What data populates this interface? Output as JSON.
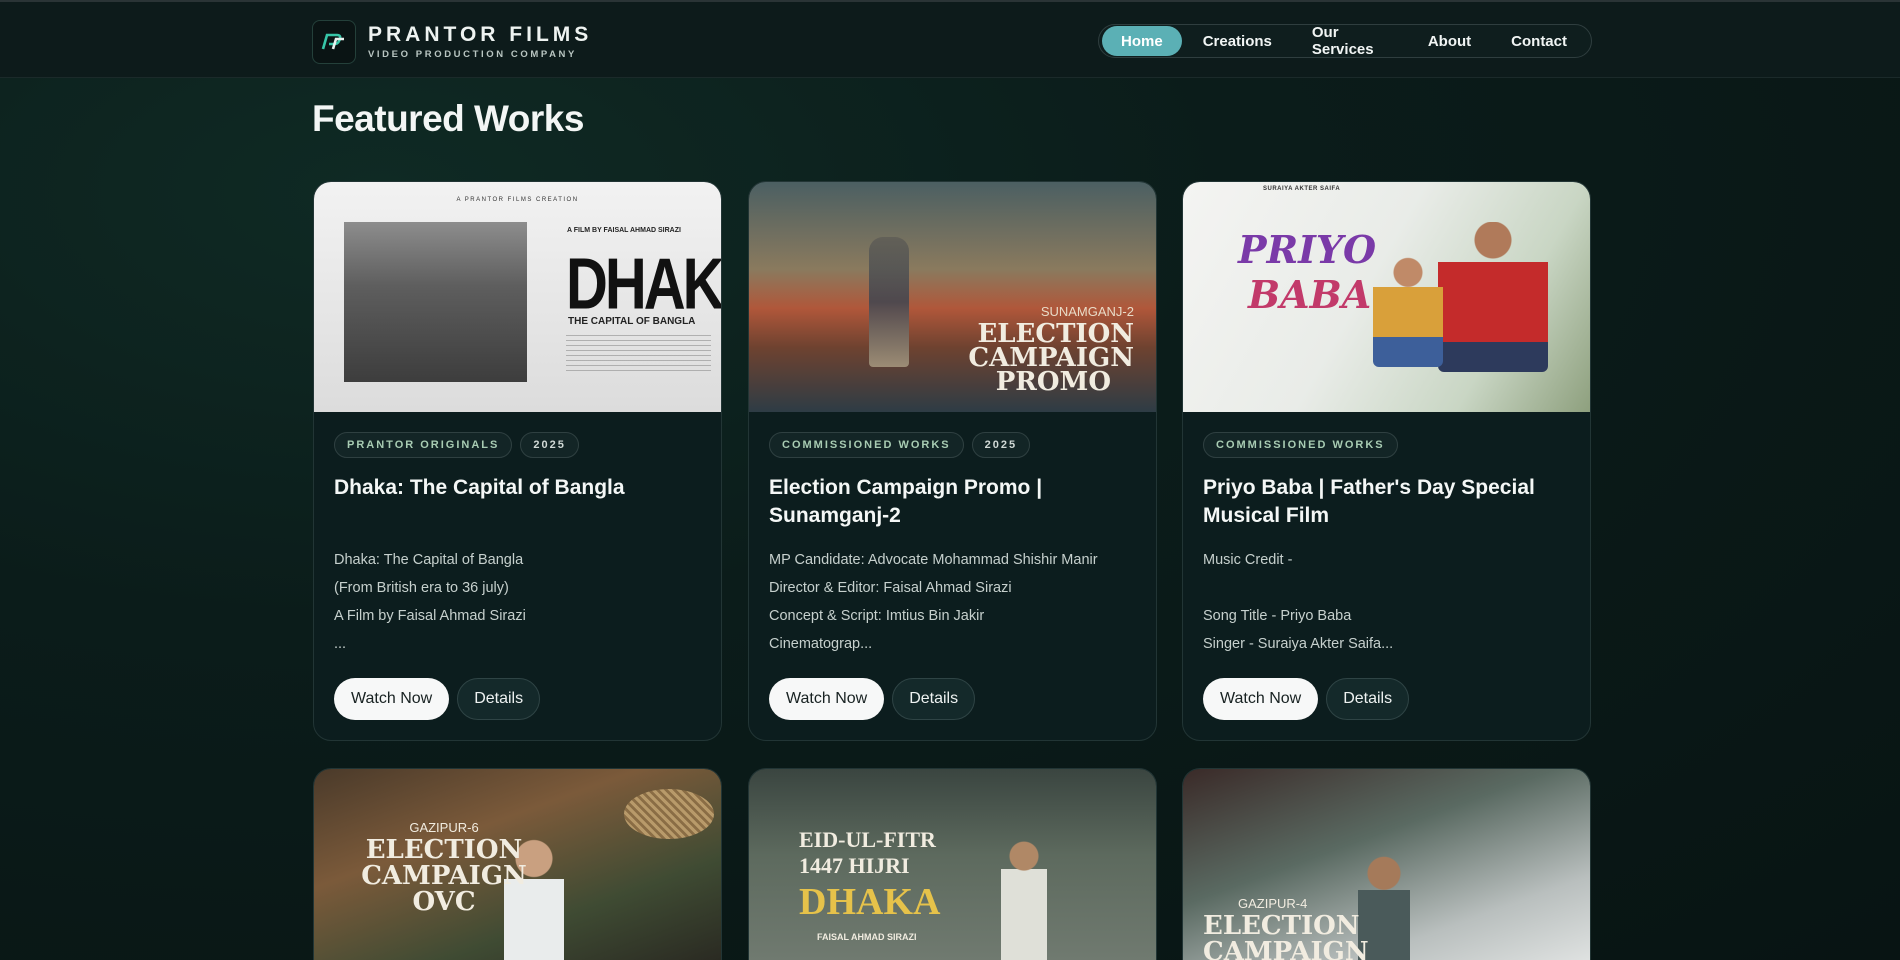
{
  "header": {
    "brand_name": "PRANTOR FILMS",
    "brand_sub": "VIDEO PRODUCTION COMPANY",
    "nav": [
      {
        "label": "Home",
        "active": true
      },
      {
        "label": "Creations",
        "active": false
      },
      {
        "label": "Our Services",
        "active": false
      },
      {
        "label": "About",
        "active": false
      },
      {
        "label": "Contact",
        "active": false
      }
    ]
  },
  "page": {
    "title": "Featured Works"
  },
  "cards": [
    {
      "tags": [
        "PRANTOR ORIGINALS",
        "2025"
      ],
      "title_lines": [
        "Dhaka: The Capital of Bangla",
        ""
      ],
      "desc": [
        "Dhaka: The Capital of Bangla",
        "(From British era to 36 july)",
        "A Film by Faisal Ahmad Sirazi",
        "..."
      ],
      "watch_label": "Watch Now",
      "details_label": "Details",
      "poster": {
        "top": "A PRANTOR FILMS CREATION",
        "film_by": "A FILM BY FAISAL AHMAD SIRAZI",
        "big": "DHAKA",
        "sub": "THE CAPITAL OF BANGLA"
      }
    },
    {
      "tags": [
        "COMMISSIONED WORKS",
        "2025"
      ],
      "title_lines": [
        "Election Campaign Promo |",
        "Sunamganj-2"
      ],
      "desc": [
        "MP Candidate: Advocate Mohammad Shishir Manir",
        "Director & Editor: Faisal Ahmad Sirazi",
        "Concept & Script: Imtius Bin Jakir",
        "Cinematograp..."
      ],
      "watch_label": "Watch Now",
      "details_label": "Details",
      "poster": {
        "l1": "SUNAMGANJ-2",
        "l2": "ELECTION",
        "l3": "CAMPAIGN",
        "l4": "PROMO"
      }
    },
    {
      "tags": [
        "COMMISSIONED WORKS"
      ],
      "title_lines": [
        "Priyo Baba | Father's Day Special",
        "Musical Film"
      ],
      "desc": [
        "Music Credit -",
        "",
        "Song Title - Priyo Baba",
        "Singer - Suraiya Akter Saifa..."
      ],
      "watch_label": "Watch Now",
      "details_label": "Details",
      "poster": {
        "top": "SURAIYA AKTER SAIFA",
        "l1": "PRIYO",
        "l2": "BABA"
      }
    }
  ],
  "row2": [
    {
      "l1": "GAZIPUR-6",
      "l2": "ELECTION",
      "l3": "CAMPAIGN",
      "l4": "OVC"
    },
    {
      "l1": "EID-UL-FITR",
      "l2": "1447 HIJRI",
      "l3": "DHAKA",
      "l4": "FAISAL AHMAD SIRAZI"
    },
    {
      "l1": "GAZIPUR-4",
      "l2": "ELECTION",
      "l3": "CAMPAIGN"
    }
  ]
}
